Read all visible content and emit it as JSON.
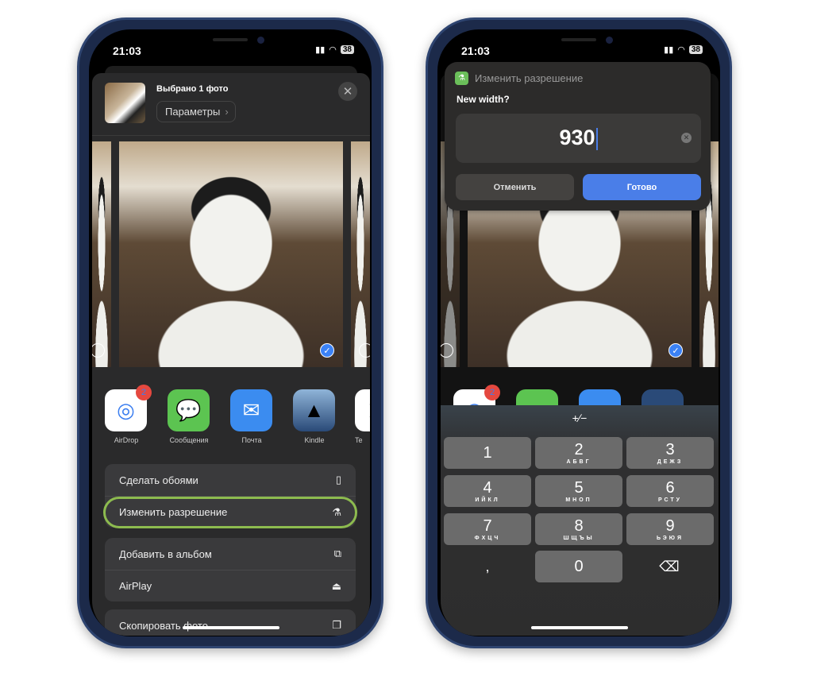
{
  "status": {
    "time": "21:03",
    "battery": "38"
  },
  "share_sheet": {
    "selected_title": "Выбрано 1 фото",
    "options_label": "Параметры",
    "apps": [
      {
        "label": "AirDrop",
        "icon": "airdrop-icon",
        "badge": "2",
        "color": "#ffffff"
      },
      {
        "label": "Сообщения",
        "icon": "messages-icon",
        "color": "#5cc451"
      },
      {
        "label": "Почта",
        "icon": "mail-icon",
        "color": "#3b8cf0"
      },
      {
        "label": "Kindle",
        "icon": "kindle-icon",
        "color": "#2a4a78"
      },
      {
        "label": "Te",
        "icon": "telegram-icon",
        "color": "#ffffff"
      }
    ],
    "actions": [
      {
        "label": "Сделать обоями",
        "icon": "phone-icon"
      },
      {
        "label": "Изменить разрешение",
        "icon": "flask-icon",
        "highlighted": true
      },
      {
        "label": "Добавить в альбом",
        "icon": "add-album-icon"
      },
      {
        "label": "AirPlay",
        "icon": "airplay-icon"
      },
      {
        "label": "Скопировать фото",
        "icon": "copy-icon"
      }
    ],
    "highlight_color": "#8dbb4f"
  },
  "dialog": {
    "app_title": "Изменить разрешение",
    "question": "New width?",
    "value": "930",
    "cancel_label": "Отменить",
    "done_label": "Готово",
    "done_color": "#4a7ee8"
  },
  "keypad": {
    "sign_toggle": "+∕−",
    "keys": [
      {
        "digit": "1",
        "letters": ""
      },
      {
        "digit": "2",
        "letters": "АБВГ"
      },
      {
        "digit": "3",
        "letters": "ДЕЖЗ"
      },
      {
        "digit": "4",
        "letters": "ИЙКЛ"
      },
      {
        "digit": "5",
        "letters": "МНОП"
      },
      {
        "digit": "6",
        "letters": "РСТУ"
      },
      {
        "digit": "7",
        "letters": "ФХЦЧ"
      },
      {
        "digit": "8",
        "letters": "ШЩЪЫ"
      },
      {
        "digit": "9",
        "letters": "ЬЭЮЯ"
      }
    ],
    "comma": ",",
    "zero": "0"
  }
}
